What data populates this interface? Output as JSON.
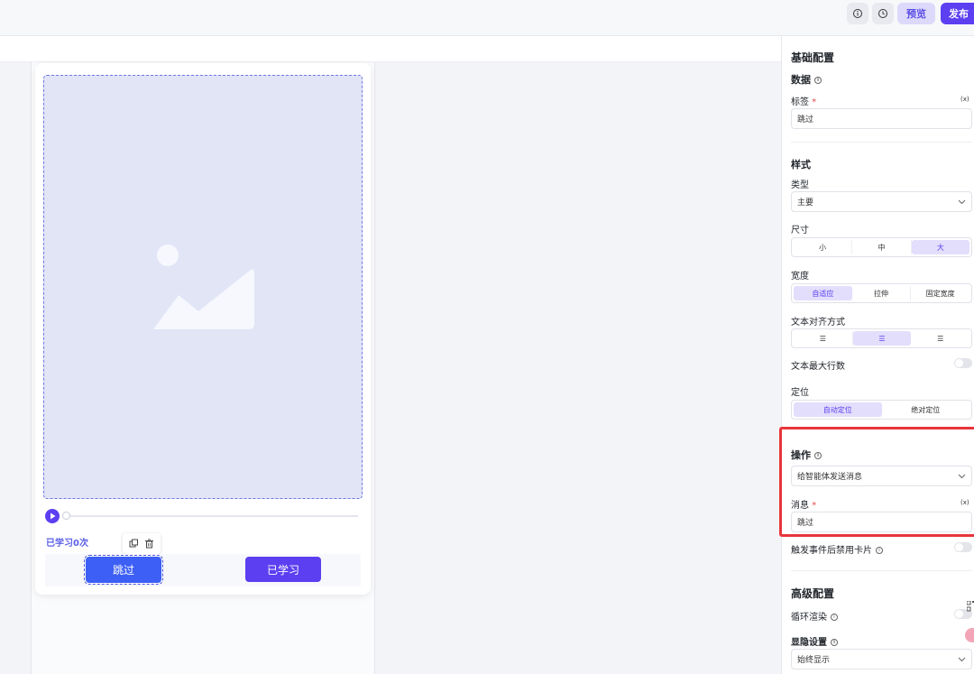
{
  "topbar": {
    "info_icon": "info-circle-icon",
    "history_icon": "clock-icon",
    "preview_label": "预览",
    "publish_label": "发布"
  },
  "canvas": {
    "image_icon": "image-placeholder-icon",
    "learned_text": "已学习0次",
    "skip_label": "跳过",
    "done_label": "已学习"
  },
  "panel": {
    "basic_title": "基础配置",
    "data_label": "数据",
    "tag_label": "标签",
    "tag_value": "跳过",
    "fx": "(x)",
    "style_title": "样式",
    "type_label": "类型",
    "type_value": "主要",
    "size_label": "尺寸",
    "size_options": [
      "小",
      "中",
      "大"
    ],
    "width_label": "宽度",
    "width_options": [
      "自适应",
      "拉伸",
      "固定宽度"
    ],
    "align_label": "文本对齐方式",
    "align_options": [
      "☰",
      "☰",
      "☰"
    ],
    "maxlines_label": "文本最大行数",
    "position_label": "定位",
    "position_options": [
      "自动定位",
      "绝对定位"
    ],
    "action_label": "操作",
    "action_value": "给智能体发送消息",
    "message_label": "消息",
    "message_value": "跳过",
    "disable_label": "触发事件后禁用卡片",
    "advanced_title": "高级配置",
    "loop_label": "循环渲染",
    "visibility_label": "显隐设置",
    "visibility_value": "始终显示",
    "required_mark": "*"
  },
  "colors": {
    "accent": "#5b3ff0",
    "primary_button": "#3d5ff5",
    "highlight": "#e8353b"
  }
}
